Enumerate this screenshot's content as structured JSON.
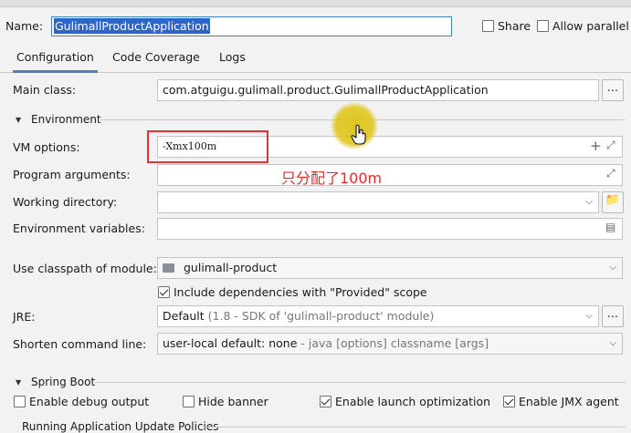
{
  "header": {
    "name_label": "Name:",
    "name_value": "GulimallProductApplication",
    "share_label": "Share",
    "allow_parallel_label": "Allow parallel r"
  },
  "tabs": [
    {
      "label": "Configuration",
      "active": true
    },
    {
      "label": "Code Coverage",
      "active": false
    },
    {
      "label": "Logs",
      "active": false
    }
  ],
  "main_class": {
    "label": "Main class:",
    "value": "com.atguigu.gulimall.product.GulimallProductApplication",
    "browse_label": "..."
  },
  "environment": {
    "section_label": "Environment",
    "vm_options": {
      "label": "VM options:",
      "value": "-Xmx100m"
    },
    "program_arguments": {
      "label": "Program arguments:",
      "value": ""
    },
    "working_directory": {
      "label": "Working directory:",
      "value": ""
    },
    "environment_variables": {
      "label": "Environment variables:",
      "value": ""
    }
  },
  "annotation": "只分配了100m",
  "classpath": {
    "label": "Use classpath of module:",
    "value": "gulimall-product",
    "include_provided_label": "Include dependencies with \"Provided\" scope",
    "include_provided_checked": true
  },
  "jre": {
    "label": "JRE:",
    "value_main": "Default",
    "value_detail": "(1.8 - SDK of 'gulimall-product' module)",
    "browse_label": "..."
  },
  "shorten": {
    "label": "Shorten command line:",
    "value_main": "user-local default: none",
    "value_detail": "- java [options] classname [args]"
  },
  "spring_boot": {
    "section_label": "Spring Boot",
    "options": [
      {
        "label": "Enable debug output",
        "checked": false
      },
      {
        "label": "Hide banner",
        "checked": false
      },
      {
        "label": "Enable launch optimization",
        "checked": true
      },
      {
        "label": "Enable JMX agent",
        "checked": true
      }
    ],
    "next_section_label": "Running Application Update Policies"
  },
  "colors": {
    "accent": "#4083c9",
    "selection": "#2f65ca",
    "annotation_red": "#e4332e",
    "cursor_highlight": "#dec414"
  }
}
